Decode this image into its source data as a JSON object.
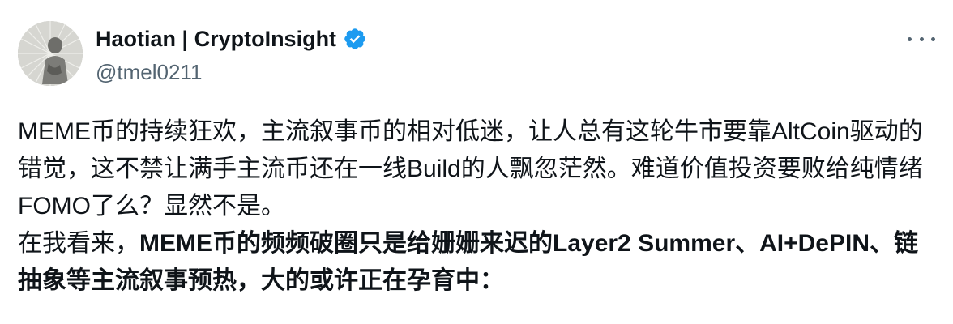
{
  "author": {
    "name": "Haotian | CryptoInsight",
    "handle": "@tmel0211",
    "verified": true,
    "verified_color": "#1d9bf0"
  },
  "more_icon": "more-horizontal-icon",
  "post": {
    "para1": "MEME币的持续狂欢，主流叙事币的相对低迷，让人总有这轮牛市要靠AltCoin驱动的错觉，这不禁让满手主流币还在一线Build的人飘忽茫然。难道价值投资要败给纯情绪FOMO了么？显然不是。",
    "para2_normal": "在我看来，",
    "para2_bold": "MEME币的频频破圈只是给姗姗来迟的Layer2 Summer、AI+DePIN、链抽象等主流叙事预热，大的或许正在孕育中："
  },
  "colors": {
    "text": "#0f1419",
    "secondary": "#536471"
  }
}
